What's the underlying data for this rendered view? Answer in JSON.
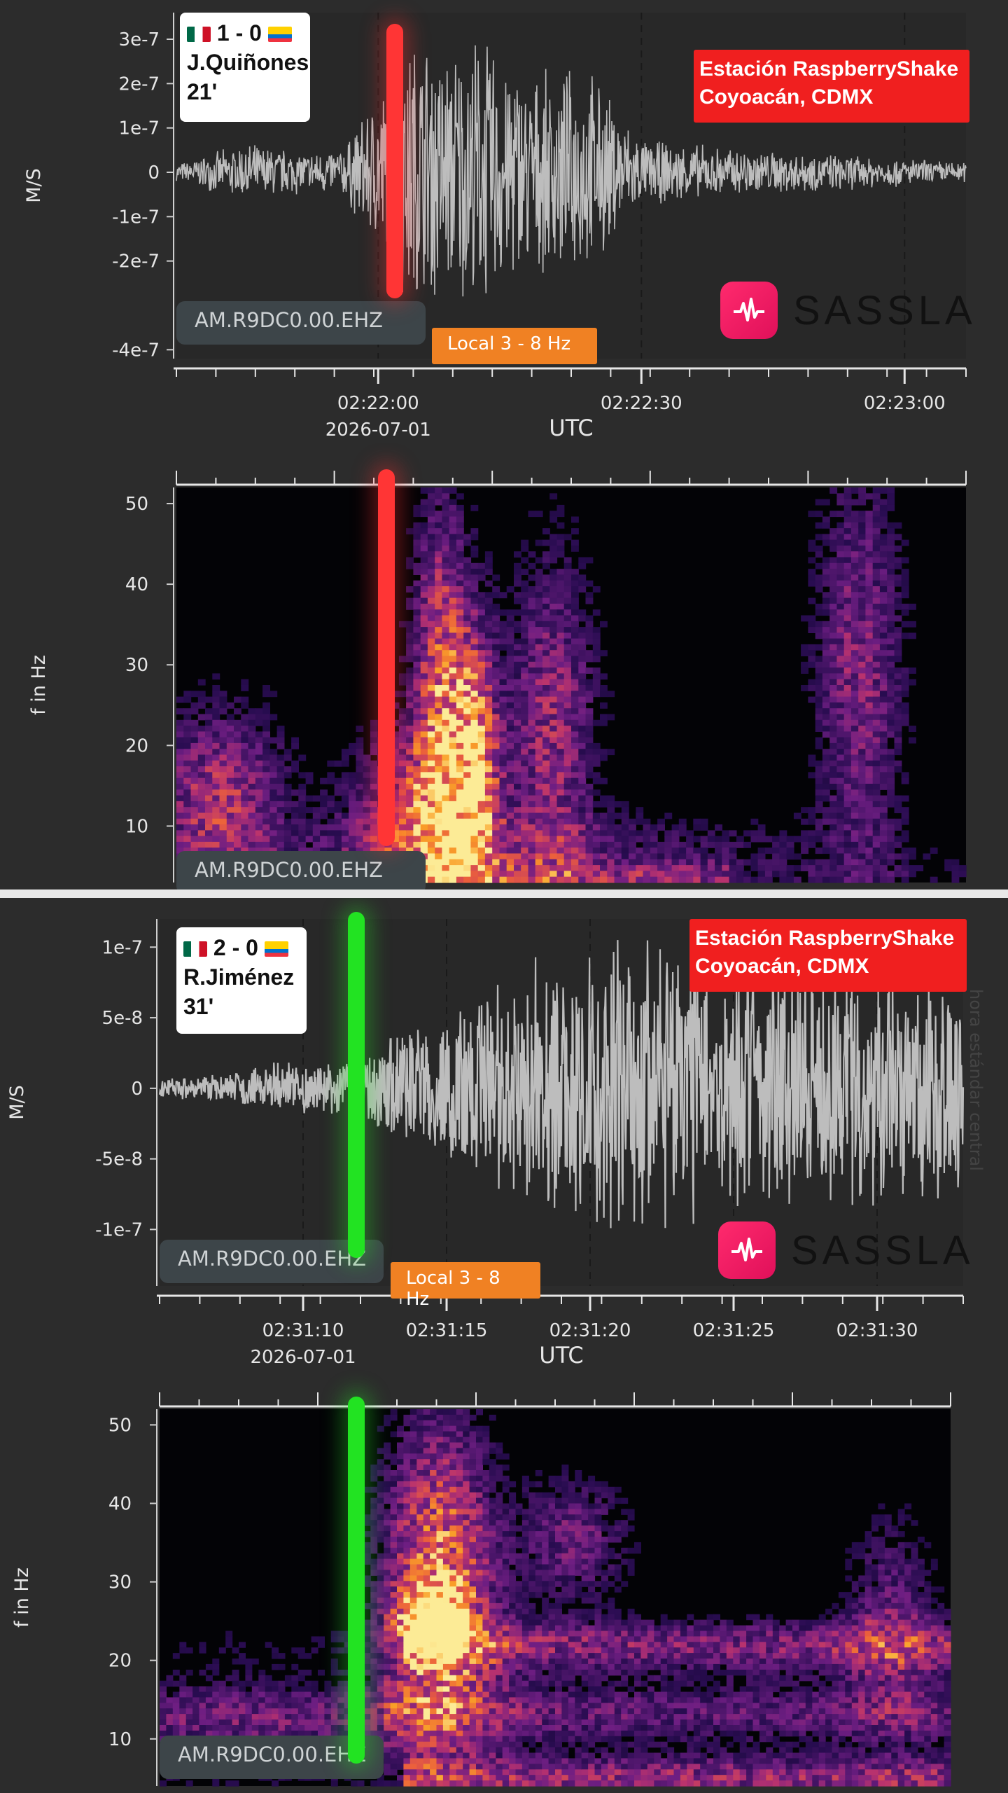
{
  "panels": [
    {
      "stamp": {
        "score": "1 - 0",
        "player": "J.Quiñones",
        "minute": "21'"
      },
      "station": {
        "line1": "Estación RaspberryShake",
        "line2": "Coyoacán, CDMX"
      },
      "channel_label": "AM.R9DC0.00.EHZ",
      "spectro_channel_label": "AM.R9DC0.00.EHZ",
      "filter_label": "Local 3 - 8 Hz",
      "brand": "SASSLA",
      "marker_color": "#ff3535"
    },
    {
      "stamp": {
        "score": "2 - 0",
        "player": "R.Jiménez",
        "minute": "31'"
      },
      "station": {
        "line1": "Estación RaspberryShake",
        "line2": "Coyoacán, CDMX"
      },
      "channel_label": "AM.R9DC0.00.EHZ",
      "spectro_channel_label": "AM.R9DC0.00.EHZ",
      "filter_label": "Local 3 - 8 Hz",
      "brand": "SASSLA",
      "marker_color": "#22e322",
      "side_text": "hora estándar central"
    }
  ],
  "chart_data": [
    {
      "type": "line",
      "ylabel": "M/S",
      "xlabel": "UTC",
      "date_label": "2026-07-01",
      "y_ticks": [
        "3e-7",
        "2e-7",
        "1e-7",
        "0",
        "-1e-7",
        "-2e-7",
        "-4e-7"
      ],
      "y_tick_values": [
        3e-07,
        2e-07,
        1e-07,
        0,
        -1e-07,
        -2e-07,
        -4e-07
      ],
      "ylim": [
        -4.2e-07,
        3.6e-07
      ],
      "x_ticks": [
        "02:22:00",
        "02:22:30",
        "02:23:00"
      ],
      "xlim": [
        "02:21:37",
        "02:23:07"
      ],
      "marker_time": "02:21:55",
      "envelope": [
        {
          "t": "02:21:37",
          "amp": 2e-08
        },
        {
          "t": "02:21:45",
          "amp": 7e-08
        },
        {
          "t": "02:21:52",
          "amp": 5e-08
        },
        {
          "t": "02:21:56",
          "amp": 6e-08
        },
        {
          "t": "02:21:59",
          "amp": 1.6e-07
        },
        {
          "t": "02:22:04",
          "amp": 3.4e-07
        },
        {
          "t": "02:22:08",
          "amp": 3.1e-07
        },
        {
          "t": "02:22:12",
          "amp": 3.3e-07
        },
        {
          "t": "02:22:18",
          "amp": 2.3e-07
        },
        {
          "t": "02:22:24",
          "amp": 2.5e-07
        },
        {
          "t": "02:22:30",
          "amp": 8e-08
        },
        {
          "t": "02:22:40",
          "amp": 6e-08
        },
        {
          "t": "02:22:55",
          "amp": 4e-08
        },
        {
          "t": "02:23:07",
          "amp": 2.5e-08
        }
      ]
    },
    {
      "type": "heatmap",
      "ylabel": "f in Hz",
      "y_ticks": [
        "50",
        "40",
        "30",
        "20",
        "10"
      ],
      "y_tick_values": [
        50,
        40,
        30,
        20,
        10
      ],
      "ylim": [
        3,
        52
      ],
      "xlim": [
        "02:21:37",
        "02:23:07"
      ],
      "marker_time": "02:21:54"
    },
    {
      "type": "line",
      "ylabel": "M/S",
      "xlabel": "UTC",
      "date_label": "2026-07-01",
      "y_ticks": [
        "1e-7",
        "5e-8",
        "0",
        "-5e-8",
        "-1e-7"
      ],
      "y_tick_values": [
        1e-07,
        5e-08,
        0,
        -5e-08,
        -1e-07
      ],
      "ylim": [
        -1.4e-07,
        1.2e-07
      ],
      "x_ticks": [
        "02:31:10",
        "02:31:15",
        "02:31:20",
        "02:31:25",
        "02:31:30"
      ],
      "xlim": [
        "02:31:05.0",
        "02:31:33.0"
      ],
      "marker_time": "02:31:11.9",
      "envelope": [
        {
          "t": "02:31:05.0",
          "amp": 8e-09
        },
        {
          "t": "02:31:07.0",
          "amp": 1e-08
        },
        {
          "t": "02:31:09.0",
          "amp": 2e-08
        },
        {
          "t": "02:31:11.5",
          "amp": 2e-08
        },
        {
          "t": "02:31:13.0",
          "amp": 4.5e-08
        },
        {
          "t": "02:31:15.0",
          "amp": 6e-08
        },
        {
          "t": "02:31:17.0",
          "amp": 8e-08
        },
        {
          "t": "02:31:19.0",
          "amp": 1.05e-07
        },
        {
          "t": "02:31:21.0",
          "amp": 1.15e-07
        },
        {
          "t": "02:31:23.0",
          "amp": 1e-07
        },
        {
          "t": "02:31:26.0",
          "amp": 9e-08
        },
        {
          "t": "02:31:29.0",
          "amp": 9.5e-08
        },
        {
          "t": "02:31:33.0",
          "amp": 8e-08
        }
      ]
    },
    {
      "type": "heatmap",
      "ylabel": "f in Hz",
      "y_ticks": [
        "50",
        "40",
        "30",
        "20",
        "10"
      ],
      "y_tick_values": [
        50,
        40,
        30,
        20,
        10
      ],
      "ylim": [
        4,
        52
      ],
      "xlim": [
        "02:31:05.0",
        "02:31:33.0"
      ],
      "marker_time": "02:31:11.9"
    }
  ]
}
